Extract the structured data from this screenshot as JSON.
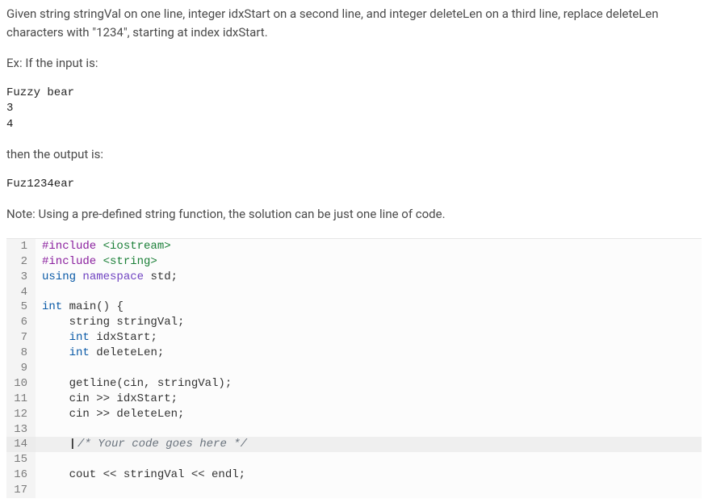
{
  "problem": {
    "p1": "Given string stringVal on one line, integer idxStart on a second line, and integer deleteLen on a third line, replace deleteLen characters with \"1234\", starting at index idxStart.",
    "p2": "Ex: If the input is:",
    "input_lines": [
      "Fuzzy bear",
      "3",
      "4"
    ],
    "p3": "then the output is:",
    "output_line": "Fuz1234ear",
    "p4": "Note: Using a pre-defined string function, the solution can be just one line of code."
  },
  "code": {
    "lines": [
      {
        "n": 1,
        "tokens": [
          [
            "pre",
            "#include"
          ],
          [
            "txt",
            " "
          ],
          [
            "str",
            "<iostream>"
          ]
        ]
      },
      {
        "n": 2,
        "tokens": [
          [
            "pre",
            "#include"
          ],
          [
            "txt",
            " "
          ],
          [
            "str",
            "<string>"
          ]
        ]
      },
      {
        "n": 3,
        "tokens": [
          [
            "kw",
            "using"
          ],
          [
            "txt",
            " "
          ],
          [
            "ns",
            "namespace"
          ],
          [
            "txt",
            " std;"
          ]
        ]
      },
      {
        "n": 4,
        "tokens": [
          [
            "txt",
            ""
          ]
        ]
      },
      {
        "n": 5,
        "tokens": [
          [
            "type",
            "int"
          ],
          [
            "txt",
            " "
          ],
          [
            "func",
            "main"
          ],
          [
            "txt",
            "() {"
          ]
        ]
      },
      {
        "n": 6,
        "tokens": [
          [
            "txt",
            "    string stringVal;"
          ]
        ]
      },
      {
        "n": 7,
        "tokens": [
          [
            "txt",
            "    "
          ],
          [
            "type",
            "int"
          ],
          [
            "txt",
            " idxStart;"
          ]
        ]
      },
      {
        "n": 8,
        "tokens": [
          [
            "txt",
            "    "
          ],
          [
            "type",
            "int"
          ],
          [
            "txt",
            " deleteLen;"
          ]
        ]
      },
      {
        "n": 9,
        "tokens": [
          [
            "txt",
            ""
          ]
        ]
      },
      {
        "n": 10,
        "tokens": [
          [
            "txt",
            "    getline(cin, stringVal);"
          ]
        ]
      },
      {
        "n": 11,
        "tokens": [
          [
            "txt",
            "    cin >> idxStart;"
          ]
        ]
      },
      {
        "n": 12,
        "tokens": [
          [
            "txt",
            "    cin >> deleteLen;"
          ]
        ]
      },
      {
        "n": 13,
        "tokens": [
          [
            "txt",
            ""
          ]
        ]
      },
      {
        "n": 14,
        "active": true,
        "tokens": [
          [
            "txt",
            "    "
          ],
          [
            "caret",
            "|"
          ],
          [
            "cmt",
            "/* Your code goes here */"
          ]
        ]
      },
      {
        "n": 15,
        "tokens": [
          [
            "txt",
            ""
          ]
        ]
      },
      {
        "n": 16,
        "tokens": [
          [
            "txt",
            "    cout << stringVal << endl;"
          ]
        ]
      },
      {
        "n": 17,
        "tokens": [
          [
            "txt",
            ""
          ]
        ]
      }
    ]
  }
}
